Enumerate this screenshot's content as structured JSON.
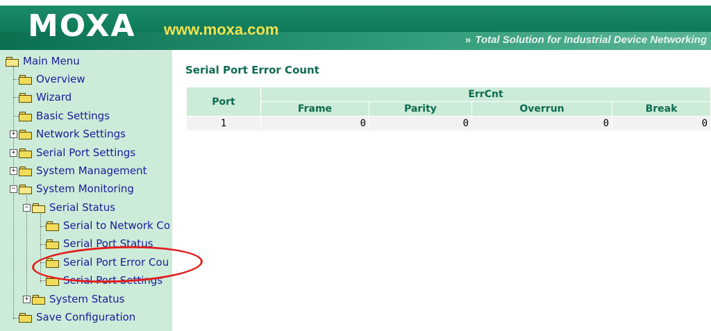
{
  "header": {
    "logo": "MOXA",
    "url": "www.moxa.com",
    "tagline": "Total Solution for Industrial Device Networking",
    "tagline_icon": "double-chevron-icon"
  },
  "sidebar": {
    "root": "Main Menu",
    "items": [
      {
        "label": "Overview"
      },
      {
        "label": "Wizard"
      },
      {
        "label": "Basic Settings"
      },
      {
        "label": "Network Settings"
      },
      {
        "label": "Serial Port Settings"
      },
      {
        "label": "System Management"
      },
      {
        "label": "System Monitoring"
      },
      {
        "label": "Serial Status"
      },
      {
        "label": "Serial to Network Co"
      },
      {
        "label": "Serial Port Status"
      },
      {
        "label": "Serial Port Error Cou"
      },
      {
        "label": "Serial Port Settings"
      },
      {
        "label": "System Status"
      },
      {
        "label": "Save Configuration"
      }
    ]
  },
  "main": {
    "title": "Serial Port Error Count",
    "table": {
      "col_port": "Port",
      "col_group": "ErrCnt",
      "subcols": [
        "Frame",
        "Parity",
        "Overrun",
        "Break"
      ],
      "rows": [
        {
          "port": "1",
          "frame": "0",
          "parity": "0",
          "overrun": "0",
          "break": "0"
        }
      ]
    }
  },
  "colors": {
    "header_green": "#0f7b5a",
    "sidebar_bg": "#ccecd9",
    "link_blue": "#1a1a9a",
    "title_green": "#0e6b4f",
    "annotation_red": "#e41c1c"
  }
}
